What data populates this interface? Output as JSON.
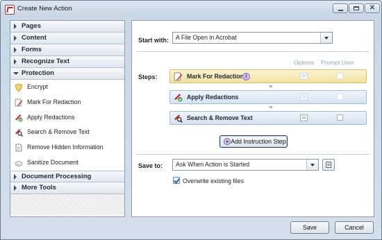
{
  "window": {
    "title": "Create New Action",
    "controls": {
      "minimize": "minimize",
      "maximize": "maximize",
      "close": "✕"
    }
  },
  "sidebar": {
    "sections_top": [
      {
        "label": "Pages"
      },
      {
        "label": "Content"
      },
      {
        "label": "Forms"
      },
      {
        "label": "Recognize Text"
      }
    ],
    "open_section": {
      "label": "Protection",
      "tools": [
        {
          "label": "Encrypt",
          "icon": "shield-icon"
        },
        {
          "label": "Mark For Redaction",
          "icon": "mark-redaction-icon"
        },
        {
          "label": "Apply Redactions",
          "icon": "apply-redactions-icon"
        },
        {
          "label": "Search & Remove Text",
          "icon": "search-remove-icon"
        },
        {
          "label": "Remove Hidden Information",
          "icon": "document-icon"
        },
        {
          "label": "Sanitize Document",
          "icon": "sanitize-icon"
        }
      ]
    },
    "sections_bottom": [
      {
        "label": "Document Processing"
      },
      {
        "label": "More Tools"
      }
    ]
  },
  "main": {
    "start_with": {
      "label": "Start with:",
      "value": "A File Open in Acrobat"
    },
    "steps": {
      "label": "Steps:",
      "col_options": "Options",
      "col_prompt": "Prompt User",
      "items": [
        {
          "label": "Mark For Redaction",
          "info": "i"
        },
        {
          "label": "Apply Redactions"
        },
        {
          "label": "Search & Remove Text"
        }
      ]
    },
    "add_step_label": "Add Instruction Step",
    "add_step_plus": "+",
    "save_to": {
      "label": "Save to:",
      "value": "Ask When Action is Started"
    },
    "overwrite_label": "Overwrite existing files",
    "overwrite_checked": true
  },
  "footer": {
    "save_label": "Save",
    "cancel_label": "Cancel"
  },
  "colors": {
    "selected_step": "#f1e19e",
    "step": "#d5e3f0",
    "accent": "#2a5d99"
  }
}
